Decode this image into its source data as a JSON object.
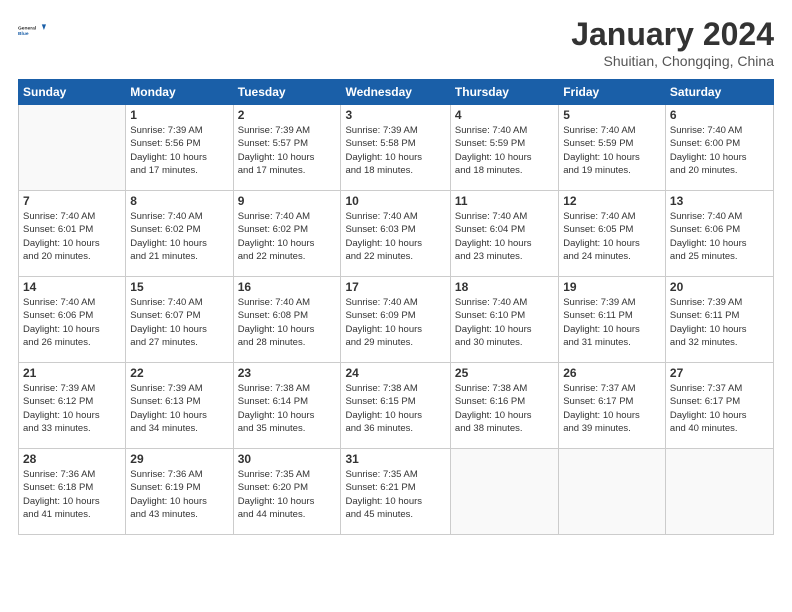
{
  "header": {
    "logo_text_general": "General",
    "logo_text_blue": "Blue",
    "month_title": "January 2024",
    "subtitle": "Shuitian, Chongqing, China"
  },
  "days_of_week": [
    "Sunday",
    "Monday",
    "Tuesday",
    "Wednesday",
    "Thursday",
    "Friday",
    "Saturday"
  ],
  "weeks": [
    [
      {
        "day": "",
        "detail": ""
      },
      {
        "day": "1",
        "detail": "Sunrise: 7:39 AM\nSunset: 5:56 PM\nDaylight: 10 hours\nand 17 minutes."
      },
      {
        "day": "2",
        "detail": "Sunrise: 7:39 AM\nSunset: 5:57 PM\nDaylight: 10 hours\nand 17 minutes."
      },
      {
        "day": "3",
        "detail": "Sunrise: 7:39 AM\nSunset: 5:58 PM\nDaylight: 10 hours\nand 18 minutes."
      },
      {
        "day": "4",
        "detail": "Sunrise: 7:40 AM\nSunset: 5:59 PM\nDaylight: 10 hours\nand 18 minutes."
      },
      {
        "day": "5",
        "detail": "Sunrise: 7:40 AM\nSunset: 5:59 PM\nDaylight: 10 hours\nand 19 minutes."
      },
      {
        "day": "6",
        "detail": "Sunrise: 7:40 AM\nSunset: 6:00 PM\nDaylight: 10 hours\nand 20 minutes."
      }
    ],
    [
      {
        "day": "7",
        "detail": "Sunrise: 7:40 AM\nSunset: 6:01 PM\nDaylight: 10 hours\nand 20 minutes."
      },
      {
        "day": "8",
        "detail": "Sunrise: 7:40 AM\nSunset: 6:02 PM\nDaylight: 10 hours\nand 21 minutes."
      },
      {
        "day": "9",
        "detail": "Sunrise: 7:40 AM\nSunset: 6:02 PM\nDaylight: 10 hours\nand 22 minutes."
      },
      {
        "day": "10",
        "detail": "Sunrise: 7:40 AM\nSunset: 6:03 PM\nDaylight: 10 hours\nand 22 minutes."
      },
      {
        "day": "11",
        "detail": "Sunrise: 7:40 AM\nSunset: 6:04 PM\nDaylight: 10 hours\nand 23 minutes."
      },
      {
        "day": "12",
        "detail": "Sunrise: 7:40 AM\nSunset: 6:05 PM\nDaylight: 10 hours\nand 24 minutes."
      },
      {
        "day": "13",
        "detail": "Sunrise: 7:40 AM\nSunset: 6:06 PM\nDaylight: 10 hours\nand 25 minutes."
      }
    ],
    [
      {
        "day": "14",
        "detail": "Sunrise: 7:40 AM\nSunset: 6:06 PM\nDaylight: 10 hours\nand 26 minutes."
      },
      {
        "day": "15",
        "detail": "Sunrise: 7:40 AM\nSunset: 6:07 PM\nDaylight: 10 hours\nand 27 minutes."
      },
      {
        "day": "16",
        "detail": "Sunrise: 7:40 AM\nSunset: 6:08 PM\nDaylight: 10 hours\nand 28 minutes."
      },
      {
        "day": "17",
        "detail": "Sunrise: 7:40 AM\nSunset: 6:09 PM\nDaylight: 10 hours\nand 29 minutes."
      },
      {
        "day": "18",
        "detail": "Sunrise: 7:40 AM\nSunset: 6:10 PM\nDaylight: 10 hours\nand 30 minutes."
      },
      {
        "day": "19",
        "detail": "Sunrise: 7:39 AM\nSunset: 6:11 PM\nDaylight: 10 hours\nand 31 minutes."
      },
      {
        "day": "20",
        "detail": "Sunrise: 7:39 AM\nSunset: 6:11 PM\nDaylight: 10 hours\nand 32 minutes."
      }
    ],
    [
      {
        "day": "21",
        "detail": "Sunrise: 7:39 AM\nSunset: 6:12 PM\nDaylight: 10 hours\nand 33 minutes."
      },
      {
        "day": "22",
        "detail": "Sunrise: 7:39 AM\nSunset: 6:13 PM\nDaylight: 10 hours\nand 34 minutes."
      },
      {
        "day": "23",
        "detail": "Sunrise: 7:38 AM\nSunset: 6:14 PM\nDaylight: 10 hours\nand 35 minutes."
      },
      {
        "day": "24",
        "detail": "Sunrise: 7:38 AM\nSunset: 6:15 PM\nDaylight: 10 hours\nand 36 minutes."
      },
      {
        "day": "25",
        "detail": "Sunrise: 7:38 AM\nSunset: 6:16 PM\nDaylight: 10 hours\nand 38 minutes."
      },
      {
        "day": "26",
        "detail": "Sunrise: 7:37 AM\nSunset: 6:17 PM\nDaylight: 10 hours\nand 39 minutes."
      },
      {
        "day": "27",
        "detail": "Sunrise: 7:37 AM\nSunset: 6:17 PM\nDaylight: 10 hours\nand 40 minutes."
      }
    ],
    [
      {
        "day": "28",
        "detail": "Sunrise: 7:36 AM\nSunset: 6:18 PM\nDaylight: 10 hours\nand 41 minutes."
      },
      {
        "day": "29",
        "detail": "Sunrise: 7:36 AM\nSunset: 6:19 PM\nDaylight: 10 hours\nand 43 minutes."
      },
      {
        "day": "30",
        "detail": "Sunrise: 7:35 AM\nSunset: 6:20 PM\nDaylight: 10 hours\nand 44 minutes."
      },
      {
        "day": "31",
        "detail": "Sunrise: 7:35 AM\nSunset: 6:21 PM\nDaylight: 10 hours\nand 45 minutes."
      },
      {
        "day": "",
        "detail": ""
      },
      {
        "day": "",
        "detail": ""
      },
      {
        "day": "",
        "detail": ""
      }
    ]
  ]
}
